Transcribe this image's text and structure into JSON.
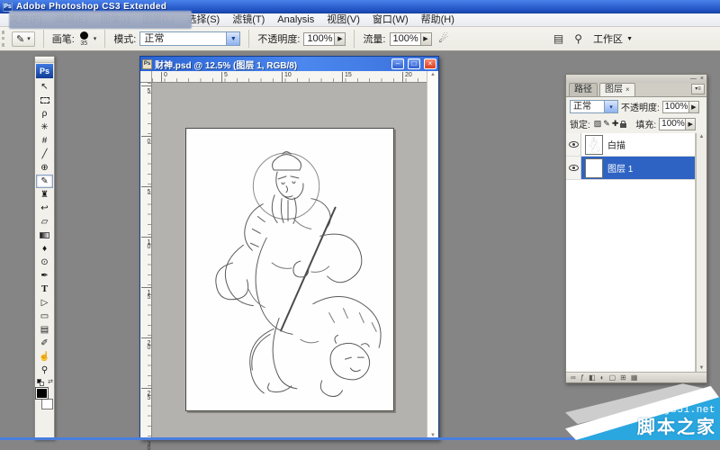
{
  "window": {
    "icon_label": "Ps",
    "title": "Adobe Photoshop CS3 Extended",
    "menus": [
      "文件(F)",
      "编辑(E)",
      "图像(I)",
      "图层(L)",
      "选择(S)",
      "滤镜(T)",
      "Analysis",
      "视图(V)",
      "窗口(W)",
      "帮助(H)"
    ]
  },
  "options_bar": {
    "tool_glyph": "✎",
    "brush_label": "画笔:",
    "brush_size": "35",
    "mode_label": "模式:",
    "mode_value": "正常",
    "opacity_label": "不透明度:",
    "opacity_value": "100%",
    "flow_label": "流量:",
    "flow_value": "100%",
    "airbrush_glyph": "☄",
    "palette_glyph": "▤",
    "bridge_glyph": "⚲",
    "workspace_label": "工作区",
    "workspace_arrow": "▼"
  },
  "toolbar": {
    "logo": "Ps",
    "tools": [
      {
        "name": "move",
        "glyph": "↖"
      },
      {
        "name": "rectangular-marquee",
        "shape": "dashbox"
      },
      {
        "name": "lasso",
        "glyph": "ρ"
      },
      {
        "name": "magic-wand",
        "glyph": "✳"
      },
      {
        "name": "crop",
        "glyph": "#"
      },
      {
        "name": "slice",
        "glyph": "╱"
      },
      {
        "name": "healing-brush",
        "glyph": "⊕"
      },
      {
        "name": "brush",
        "glyph": "✎",
        "selected": true
      },
      {
        "name": "clone-stamp",
        "glyph": "♜"
      },
      {
        "name": "history-brush",
        "glyph": "↩"
      },
      {
        "name": "eraser",
        "glyph": "▱"
      },
      {
        "name": "gradient",
        "shape": "gradbox"
      },
      {
        "name": "blur",
        "glyph": "♦"
      },
      {
        "name": "dodge",
        "glyph": "⊙"
      },
      {
        "name": "pen",
        "glyph": "✒"
      },
      {
        "name": "type",
        "glyph": "T",
        "serif": true
      },
      {
        "name": "path-selection",
        "glyph": "▷"
      },
      {
        "name": "shape",
        "glyph": "▭"
      },
      {
        "name": "notes",
        "glyph": "▤"
      },
      {
        "name": "eyedropper",
        "glyph": "✐"
      },
      {
        "name": "hand",
        "glyph": "☝"
      },
      {
        "name": "zoom",
        "glyph": "⚲"
      }
    ],
    "foreground_color": "#000000",
    "background_color": "#ffffff"
  },
  "document": {
    "icon_label": "Ps",
    "title": "财神.psd @ 12.5% (图层 1, RGB/8)",
    "zoom_level": "12.5%",
    "window_buttons": {
      "minimize": "–",
      "maximize": "□",
      "close": "×"
    },
    "ruler_h": [
      "0",
      "5",
      "10",
      "15",
      "20"
    ],
    "ruler_v": [
      "5",
      "0",
      "5",
      "10",
      "15",
      "20",
      "25",
      "30"
    ],
    "scroll_up": "▲",
    "scroll_down": "▼"
  },
  "layers_panel": {
    "window_buttons": {
      "minimize": "—",
      "close": "×"
    },
    "tabs": [
      {
        "label": "路径",
        "active": false
      },
      {
        "label": "图层",
        "active": true,
        "close": "×"
      }
    ],
    "panel_menu_glyph": "▾≡",
    "blend_mode": "正常",
    "select_chevron": "▾",
    "opacity_label": "不透明度:",
    "opacity_value": "100%",
    "slider_button": "▶",
    "lock_label": "锁定:",
    "lock_icons": [
      {
        "name": "lock-transparency-icon",
        "glyph": "▨"
      },
      {
        "name": "lock-image-icon",
        "glyph": "✎"
      },
      {
        "name": "lock-position-icon",
        "glyph": "✚"
      },
      {
        "name": "lock-all-icon",
        "shape": "lock"
      }
    ],
    "fill_label": "填充:",
    "fill_value": "100%",
    "layers": [
      {
        "name": "白描",
        "selected": false,
        "thumb": "art"
      },
      {
        "name": "图层 1",
        "selected": true,
        "thumb": "white"
      }
    ],
    "scroll_up": "▲",
    "scroll_down": "▼",
    "bottom_icons": [
      {
        "name": "link-layers-icon",
        "glyph": "∞"
      },
      {
        "name": "layer-style-icon",
        "glyph": "ƒ"
      },
      {
        "name": "layer-mask-icon",
        "glyph": "◧"
      },
      {
        "name": "adjustment-layer-icon",
        "glyph": "◐"
      },
      {
        "name": "layer-group-icon",
        "glyph": "▢"
      },
      {
        "name": "new-layer-icon",
        "glyph": "⊞"
      },
      {
        "name": "delete-layer-icon",
        "glyph": "▦"
      }
    ]
  },
  "watermark": {
    "site": "jb51.net",
    "name": "脚本之家"
  },
  "colors": {
    "titlebar_blue": "#2a5fd0",
    "workspace_gray": "#858585",
    "selected_layer_blue": "#2e63c4",
    "watermark_blue": "#2ba7e0",
    "canvas_gray": "#b3b2ae"
  }
}
